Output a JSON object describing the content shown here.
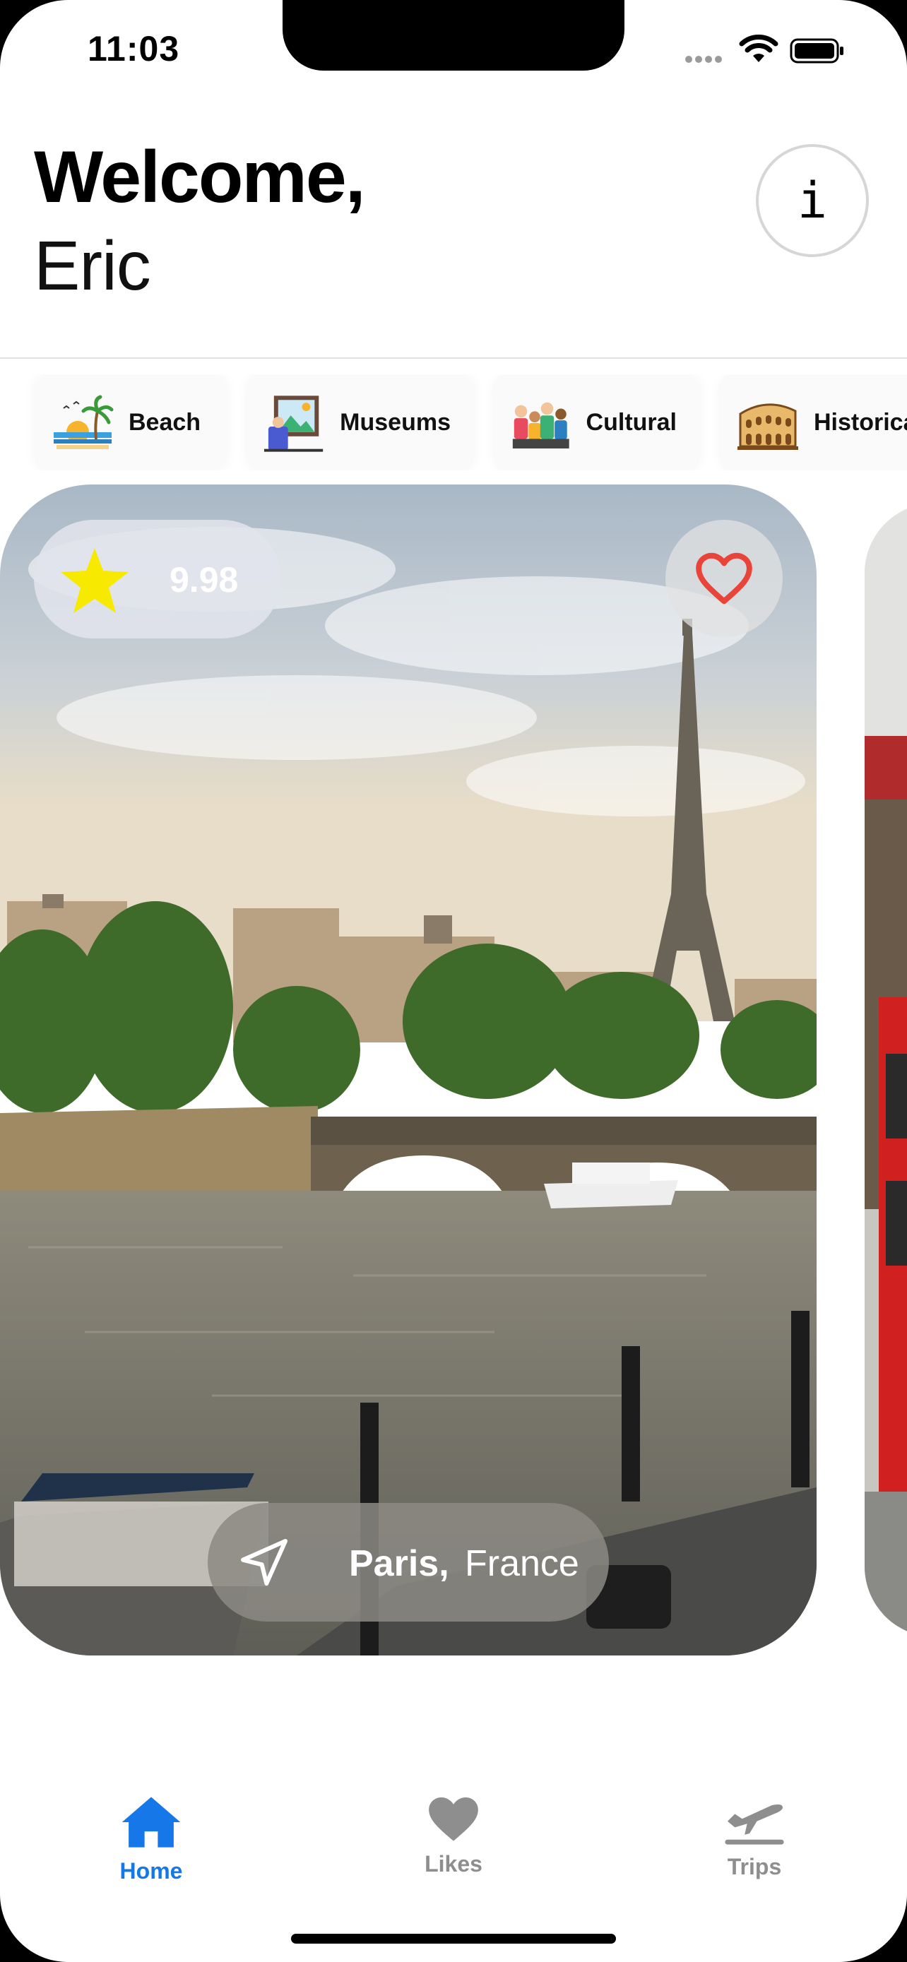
{
  "status_bar": {
    "time": "11:03"
  },
  "header": {
    "greeting": "Welcome,",
    "username": "Eric",
    "info_label": "i"
  },
  "categories": [
    {
      "label": "Beach",
      "icon": "beach-icon"
    },
    {
      "label": "Museums",
      "icon": "museum-icon"
    },
    {
      "label": "Cultural",
      "icon": "people-icon"
    },
    {
      "label": "Historica",
      "icon": "colosseum-icon"
    }
  ],
  "destination": {
    "rating": "9.98",
    "city": "Paris,",
    "country": "France",
    "favorite": false
  },
  "tabbar": {
    "tabs": [
      {
        "label": "Home",
        "icon": "home-icon",
        "active": true
      },
      {
        "label": "Likes",
        "icon": "heart-icon",
        "active": false
      },
      {
        "label": "Trips",
        "icon": "airplane-icon",
        "active": false
      }
    ]
  },
  "colors": {
    "accent": "#1577e8",
    "heart": "#e8443a",
    "star": "#f7ea00",
    "inactive": "#8e8e8e"
  }
}
